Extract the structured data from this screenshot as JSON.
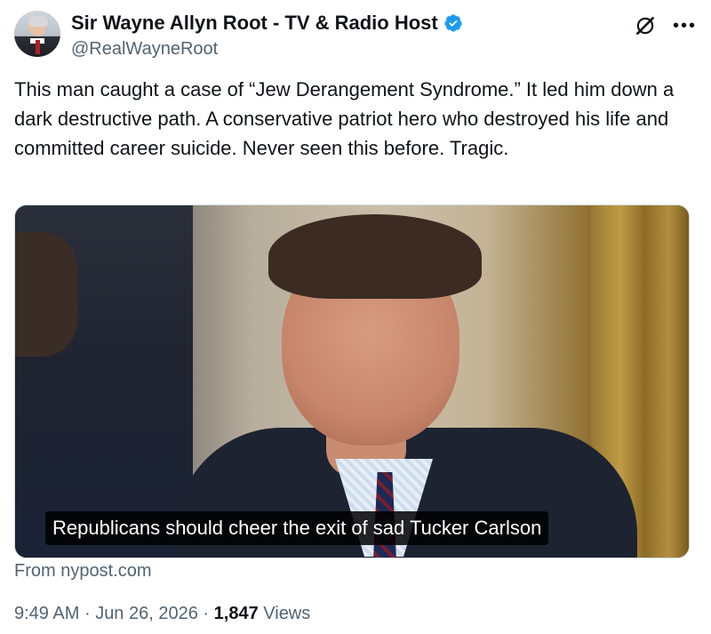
{
  "author": {
    "display_name": "Sir Wayne Allyn Root - TV & Radio Host",
    "handle": "@RealWayneRoot",
    "verified": true
  },
  "tweet": {
    "text": "This man caught a case of “Jew Derangement Syndrome.” It led him down a dark destructive path. A conservative patriot hero who destroyed his life and committed career suicide. Never seen this before. Tragic."
  },
  "media": {
    "caption": "Republicans should cheer the exit of sad Tucker Carlson"
  },
  "card": {
    "source": "From nypost.com"
  },
  "meta": {
    "time": "9:49 AM",
    "separator1": "·",
    "date": "Jun 26, 2026",
    "separator2": "·",
    "views_count": "1,847",
    "views_label": "Views"
  },
  "icons": {
    "verified": "verified-badge-icon",
    "grok": "grok-icon",
    "more": "more-icon"
  },
  "colors": {
    "text": "#0f1419",
    "secondary": "#536471",
    "verified": "#1d9bf0",
    "border": "#cfd9de"
  }
}
